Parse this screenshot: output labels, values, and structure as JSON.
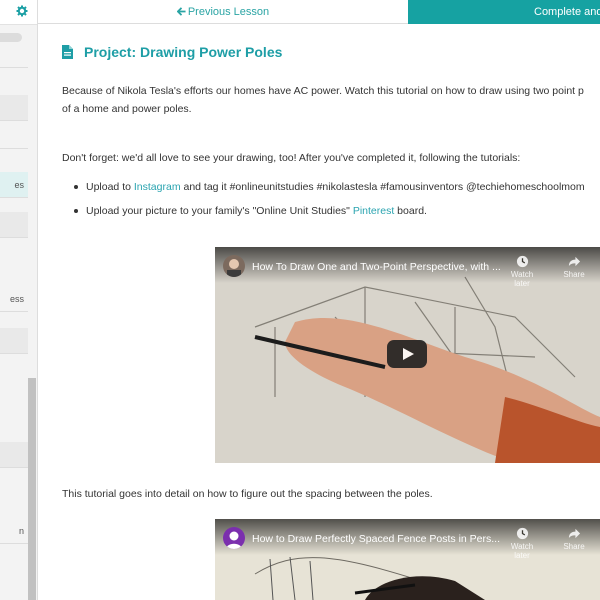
{
  "topbar": {
    "prev_label": "Previous Lesson",
    "complete_label": "Complete and"
  },
  "sidebar": {
    "items": [
      {
        "label": ""
      },
      {
        "label": ""
      },
      {
        "label": "es"
      },
      {
        "label": ""
      },
      {
        "label": "ess"
      },
      {
        "label": ""
      },
      {
        "label": ""
      },
      {
        "label": "n"
      }
    ]
  },
  "lesson": {
    "title": "Project: Drawing Power Poles",
    "intro_line1": "Because of Nikola Tesla's efforts our homes have AC power. Watch this tutorial on how to draw using two point p",
    "intro_line2": "of a home and power poles.",
    "reminder": "Don't forget: we'd all love to see your drawing, too! After you've completed it, following the tutorials:",
    "bullet1_pre": "Upload to ",
    "bullet1_link": "Instagram",
    "bullet1_post": " and tag it #onlineunitstudies #nikolastesla #famousinventors @techiehomeschoolmom",
    "bullet2_pre": "Upload your picture to your family's \"Online Unit Studies\" ",
    "bullet2_link": "Pinterest",
    "bullet2_post": " board.",
    "spacing_text": "This tutorial goes into detail on how to figure out the spacing between the poles."
  },
  "videos": [
    {
      "title": "How To Draw One and Two-Point Perspective, with ...",
      "watch_later": "Watch later",
      "share": "Share"
    },
    {
      "title": "How to Draw Perfectly Spaced Fence Posts in Pers...",
      "watch_later": "Watch later",
      "share": "Share"
    }
  ],
  "colors": {
    "accent": "#16a2a2",
    "title": "#1e9ea6",
    "link": "#2aa4b0"
  },
  "icons": [
    "gear-icon",
    "arrow-left-icon",
    "document-icon",
    "clock-icon",
    "share-icon",
    "play-icon"
  ]
}
